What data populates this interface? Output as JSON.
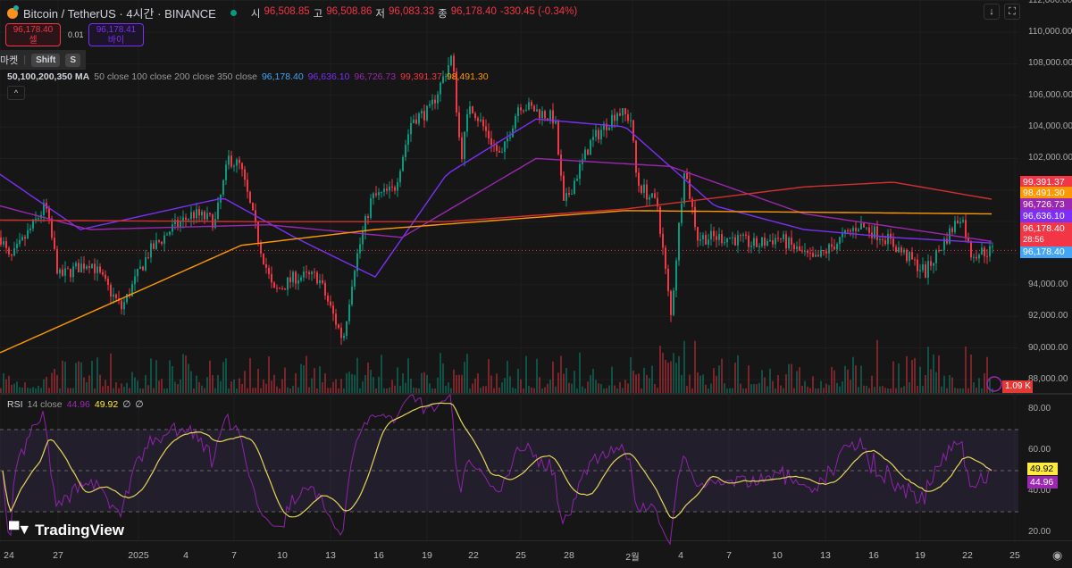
{
  "header": {
    "symbol": "Bitcoin / TetherUS · 4시간 · BINANCE",
    "o_label": "시",
    "o": "96,508.85",
    "h_label": "고",
    "h": "96,508.86",
    "l_label": "저",
    "l": "96,083.33",
    "c_label": "종",
    "c": "96,178.40",
    "change": "-330.45 (-0.34%)"
  },
  "trade": {
    "sell_price": "96,178.40",
    "sell_label": "셀",
    "spread": "0.01",
    "buy_price": "96,178.41",
    "buy_label": "바이"
  },
  "market_hint": {
    "label": "마켓",
    "key1": "Shift",
    "key2": "S"
  },
  "ma_legend": {
    "name": "50,100,200,350 MA",
    "params": "50 close 100 close 200 close 350 close",
    "v1": "96,178.40",
    "v2": "96,636.10",
    "v3": "96,726.73",
    "v4": "99,391.37",
    "v5": "98,491.30"
  },
  "rsi_legend": {
    "name": "RSI",
    "params": "14 close",
    "rsi": "44.96",
    "ma": "49.92",
    "e1": "∅",
    "e2": "∅"
  },
  "price_labels": [
    {
      "text": "99,391.37",
      "color": "#f23645",
      "value": 99391.37
    },
    {
      "text": "98,491.30",
      "color": "#ff9800",
      "value": 98491.3
    },
    {
      "text": "96,726.73",
      "color": "#9c27b0",
      "value": 96726.73
    },
    {
      "text": "96,636.10",
      "color": "#7b2ff7",
      "value": 96636.1
    },
    {
      "text": "96,178.40",
      "color": "#f23645",
      "value": 96178.4
    },
    {
      "text": "96,178.40",
      "color": "#42a5f5",
      "value": 96178.4
    }
  ],
  "countdown": "28:56",
  "volume_label": "1.09 K",
  "rsi_labels": [
    {
      "text": "49.92",
      "color": "#ffeb3b"
    },
    {
      "text": "44.96",
      "color": "#9c27b0"
    }
  ],
  "price_ticks": [
    "112,000.00",
    "110,000.00",
    "108,000.00",
    "106,000.00",
    "104,000.00",
    "102,000.00",
    "94,000.00",
    "92,000.00",
    "90,000.00",
    "88,000.00"
  ],
  "rsi_ticks": [
    "80.00",
    "60.00",
    "40.00",
    "20.00"
  ],
  "time_ticks": [
    "24",
    "27",
    "2025",
    "4",
    "7",
    "10",
    "13",
    "16",
    "19",
    "22",
    "25",
    "28",
    "2월",
    "4",
    "7",
    "10",
    "13",
    "16",
    "19",
    "22",
    "25"
  ],
  "brand": "TradingView",
  "chart_data": {
    "type": "candlestick",
    "symbol": "BTCUSDT",
    "interval": "4h",
    "ylim": [
      87500,
      112000
    ],
    "price_path": [
      [
        0,
        97000
      ],
      [
        10,
        95500
      ],
      [
        50,
        99000
      ],
      [
        65,
        94500
      ],
      [
        100,
        95500
      ],
      [
        135,
        92500
      ],
      [
        165,
        96000
      ],
      [
        190,
        97500
      ],
      [
        215,
        98500
      ],
      [
        240,
        98000
      ],
      [
        255,
        102000
      ],
      [
        268,
        101500
      ],
      [
        290,
        96500
      ],
      [
        305,
        93500
      ],
      [
        330,
        94500
      ],
      [
        355,
        94500
      ],
      [
        383,
        90500
      ],
      [
        395,
        95000
      ],
      [
        415,
        99500
      ],
      [
        440,
        100000
      ],
      [
        460,
        104500
      ],
      [
        480,
        105000
      ],
      [
        505,
        108500
      ],
      [
        515,
        102000
      ],
      [
        525,
        105500
      ],
      [
        545,
        103500
      ],
      [
        560,
        102000
      ],
      [
        580,
        105500
      ],
      [
        620,
        104500
      ],
      [
        630,
        99000
      ],
      [
        660,
        103000
      ],
      [
        690,
        105000
      ],
      [
        705,
        104500
      ],
      [
        712,
        100500
      ],
      [
        735,
        99000
      ],
      [
        750,
        92000
      ],
      [
        765,
        101500
      ],
      [
        780,
        97000
      ],
      [
        816,
        97000
      ],
      [
        845,
        96500
      ],
      [
        870,
        97000
      ],
      [
        910,
        95500
      ],
      [
        960,
        97800
      ],
      [
        990,
        97000
      ],
      [
        1020,
        95500
      ],
      [
        1035,
        94800
      ],
      [
        1075,
        98500
      ],
      [
        1085,
        96000
      ],
      [
        1113,
        96178
      ]
    ],
    "ma50": [
      [
        0,
        101000
      ],
      [
        90,
        97500
      ],
      [
        250,
        99500
      ],
      [
        330,
        97000
      ],
      [
        420,
        94500
      ],
      [
        500,
        101000
      ],
      [
        600,
        104500
      ],
      [
        700,
        104000
      ],
      [
        800,
        99000
      ],
      [
        900,
        97500
      ],
      [
        1000,
        97000
      ],
      [
        1113,
        96636
      ]
    ],
    "ma100": [
      [
        0,
        99000
      ],
      [
        100,
        97500
      ],
      [
        300,
        97800
      ],
      [
        450,
        97000
      ],
      [
        600,
        102000
      ],
      [
        750,
        101500
      ],
      [
        900,
        98500
      ],
      [
        1113,
        96727
      ]
    ],
    "ma200": [
      [
        0,
        98100
      ],
      [
        280,
        98000
      ],
      [
        500,
        98000
      ],
      [
        700,
        98800
      ],
      [
        900,
        100200
      ],
      [
        1000,
        100500
      ],
      [
        1113,
        99391
      ]
    ],
    "ma350": [
      [
        0,
        89700
      ],
      [
        270,
        96500
      ],
      [
        420,
        97500
      ],
      [
        700,
        98700
      ],
      [
        1113,
        98491
      ]
    ],
    "rsi_bands": [
      70,
      50,
      30
    ]
  }
}
